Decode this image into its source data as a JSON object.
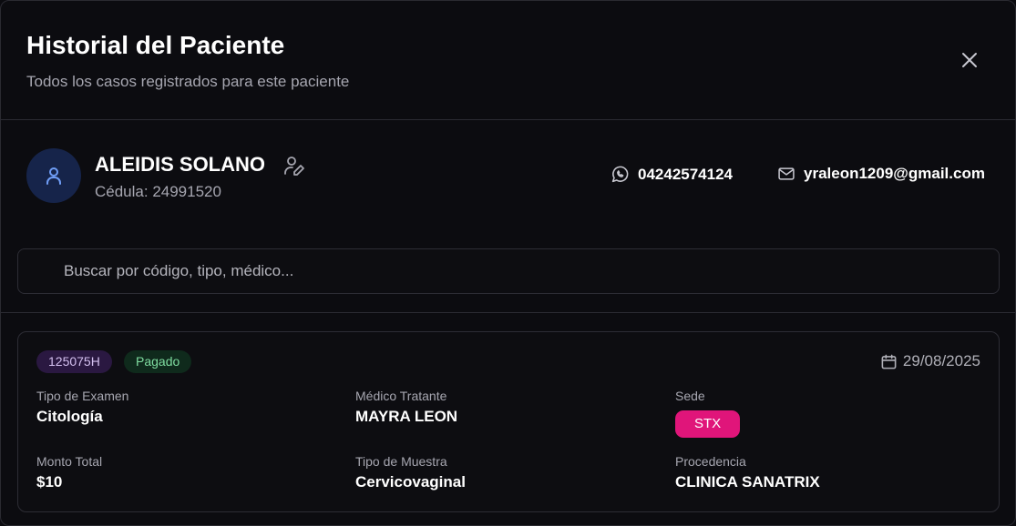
{
  "header": {
    "title": "Historial del Paciente",
    "subtitle": "Todos los casos registrados para este paciente",
    "close_icon": "close-icon"
  },
  "patient": {
    "avatar_icon": "user-icon",
    "name": "ALEIDIS SOLANO",
    "edit_icon": "user-pen-icon",
    "cedula": "Cédula: 24991520",
    "phone_icon": "whatsapp-icon",
    "phone": "04242574124",
    "email_icon": "mail-icon",
    "email": "yraleon1209@gmail.com"
  },
  "search": {
    "placeholder": "Buscar por código, tipo, médico...",
    "value": ""
  },
  "cases": [
    {
      "code": "125075H",
      "status": "Pagado",
      "date_icon": "calendar-icon",
      "date": "29/08/2025",
      "fields": {
        "exam_type_label": "Tipo de Examen",
        "exam_type": "Citología",
        "doctor_label": "Médico Tratante",
        "doctor": "MAYRA LEON",
        "sede_label": "Sede",
        "sede": "STX",
        "amount_label": "Monto Total",
        "amount": "$10",
        "sample_type_label": "Tipo de Muestra",
        "sample_type": "Cervicovaginal",
        "origin_label": "Procedencia",
        "origin": "CLINICA SANATRIX"
      }
    }
  ],
  "colors": {
    "background": "#0c0c10",
    "sede_chip": "#e0157a",
    "code_badge_bg": "#2a1841",
    "paid_badge_bg": "#0f2a1c",
    "paid_badge_text": "#7fdca0",
    "avatar_bg": "#16244a"
  }
}
